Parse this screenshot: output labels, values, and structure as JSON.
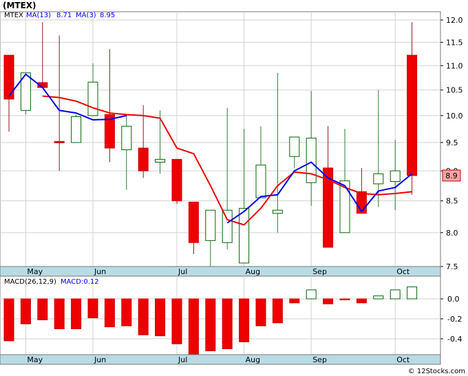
{
  "chart_title": "(MTEX)",
  "chart_data": [
    {
      "type": "candlestick",
      "ticker": "MTEX",
      "legend": [
        {
          "label": "MTEX",
          "color": "#000000"
        },
        {
          "label": "MA(13)",
          "value": "8.71",
          "color": "#ff0000"
        },
        {
          "label": "MA(3)",
          "value": "8.95",
          "color": "#0000ff"
        }
      ],
      "x_labels": [
        {
          "label": "May",
          "index": 1
        },
        {
          "label": "Jun",
          "index": 5
        },
        {
          "label": "Jul",
          "index": 10
        },
        {
          "label": "Aug",
          "index": 14
        },
        {
          "label": "Sep",
          "index": 18
        },
        {
          "label": "Oct",
          "index": 23
        }
      ],
      "y_ticks": [
        7.5,
        8.0,
        8.5,
        9.0,
        9.5,
        10.0,
        10.5,
        11.0,
        11.5,
        12.0
      ],
      "y_tick_labels": [
        "7.5",
        "8.0",
        "8.5",
        "9.0",
        "9.5",
        "10.0",
        "10.5",
        "11.0",
        "11.5",
        "12.0"
      ],
      "log_scale": true,
      "last_price_label": "8.9",
      "candles": [
        {
          "o": 11.22,
          "h": 11.22,
          "l": 9.7,
          "c": 10.32
        },
        {
          "o": 10.1,
          "h": 10.85,
          "l": 10.02,
          "c": 10.85
        },
        {
          "o": 10.65,
          "h": 11.95,
          "l": 10.55,
          "c": 10.55
        },
        {
          "o": 9.52,
          "h": 11.65,
          "l": 9.0,
          "c": 9.5
        },
        {
          "o": 9.5,
          "h": 10.02,
          "l": 9.5,
          "c": 9.98
        },
        {
          "o": 10.0,
          "h": 11.05,
          "l": 10.0,
          "c": 10.66
        },
        {
          "o": 10.02,
          "h": 11.35,
          "l": 9.15,
          "c": 9.4
        },
        {
          "o": 9.37,
          "h": 10.0,
          "l": 8.68,
          "c": 9.8
        },
        {
          "o": 9.4,
          "h": 10.2,
          "l": 8.88,
          "c": 9.0
        },
        {
          "o": 9.15,
          "h": 10.1,
          "l": 8.95,
          "c": 9.2
        },
        {
          "o": 9.2,
          "h": 9.2,
          "l": 8.45,
          "c": 8.5
        },
        {
          "o": 8.48,
          "h": 8.48,
          "l": 7.68,
          "c": 7.85
        },
        {
          "o": 7.88,
          "h": 8.25,
          "l": 7.4,
          "c": 8.35
        },
        {
          "o": 7.85,
          "h": 10.15,
          "l": 7.75,
          "c": 8.35
        },
        {
          "o": 7.55,
          "h": 9.75,
          "l": 7.55,
          "c": 8.38
        },
        {
          "o": 8.55,
          "h": 9.8,
          "l": 8.55,
          "c": 9.1
        },
        {
          "o": 8.3,
          "h": 10.85,
          "l": 8.0,
          "c": 8.35
        },
        {
          "o": 9.25,
          "h": 9.6,
          "l": 9.05,
          "c": 9.6
        },
        {
          "o": 8.8,
          "h": 10.48,
          "l": 8.42,
          "c": 9.58
        },
        {
          "o": 9.05,
          "h": 9.8,
          "l": 7.78,
          "c": 7.78
        },
        {
          "o": 8.0,
          "h": 9.75,
          "l": 8.0,
          "c": 8.83
        },
        {
          "o": 8.65,
          "h": 9.05,
          "l": 8.3,
          "c": 8.3
        },
        {
          "o": 8.78,
          "h": 10.5,
          "l": 8.4,
          "c": 8.95
        },
        {
          "o": 8.82,
          "h": 9.55,
          "l": 8.35,
          "c": 9.0
        },
        {
          "o": 11.22,
          "h": 11.95,
          "l": 8.6,
          "c": 8.92
        }
      ],
      "ma13": [
        10.38,
        10.35,
        10.28,
        10.15,
        10.05,
        10.02,
        10.0,
        9.95,
        9.4,
        9.3,
        8.75,
        8.2,
        8.12,
        8.38,
        8.75,
        8.98,
        8.95,
        8.85,
        8.72,
        8.62,
        8.6,
        8.62,
        8.65
      ],
      "ma13_start_index": 2,
      "ma3": [
        10.38,
        10.82,
        10.55,
        10.1,
        10.05,
        9.92,
        9.93,
        10.0
      ],
      "ma3_start_index": 0,
      "ma3_recent": [
        8.15,
        8.33,
        8.57,
        8.6,
        9.0,
        9.15,
        8.88,
        8.75,
        8.33,
        8.66,
        8.72,
        8.95
      ],
      "ma3_recent_start_index": 13
    },
    {
      "type": "bar",
      "title": "MACD(26,12,9)",
      "legend": [
        {
          "label": "MACD(26,12,9)",
          "color": "#000000"
        },
        {
          "label": "MACD:0.12",
          "color": "#0000ff"
        }
      ],
      "y_ticks": [
        0.0,
        -0.2,
        -0.4
      ],
      "y_tick_labels": [
        "0.0",
        "-0.2",
        "-0.4"
      ],
      "values": [
        -0.42,
        -0.25,
        -0.21,
        -0.3,
        -0.3,
        -0.19,
        -0.28,
        -0.27,
        -0.36,
        -0.37,
        -0.45,
        -0.56,
        -0.52,
        -0.5,
        -0.43,
        -0.27,
        -0.24,
        -0.04,
        0.09,
        -0.05,
        -0.01,
        -0.04,
        0.03,
        0.09,
        0.12
      ]
    }
  ],
  "footer": {
    "copyright": "© 12Stocks.com"
  }
}
